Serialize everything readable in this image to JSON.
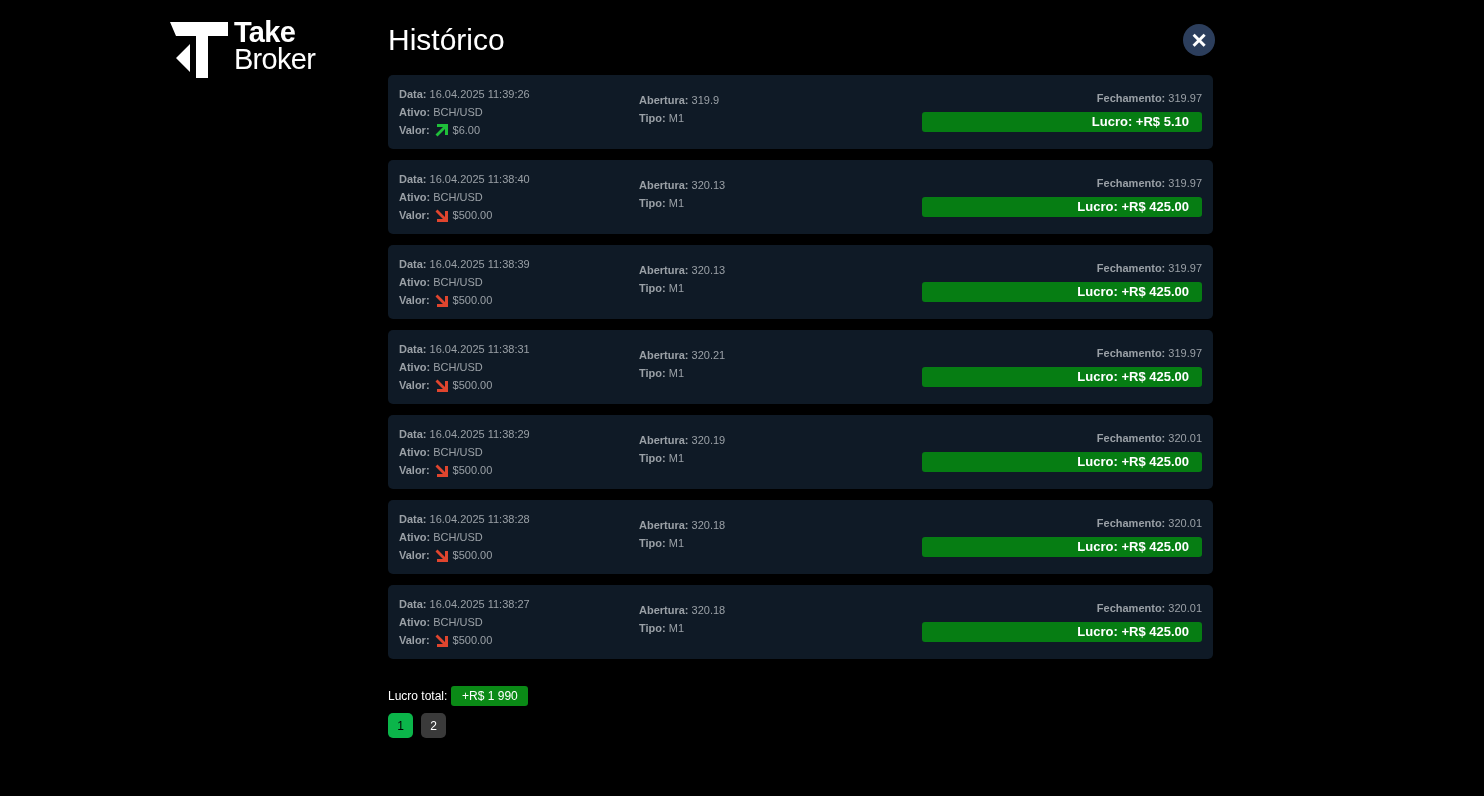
{
  "logo": {
    "line_1": "Take",
    "line_2": "Broker"
  },
  "title": "Histórico",
  "close": "×",
  "trades": [
    {
      "data": "**Data:** 16.04.2025 11:39:26",
      "ativo": "**Ativo:** BCH/USD",
      "valor_label": "Valor:",
      "kind": "up",
      "valor": "$6.00",
      "abertura": "**Abertura:** 319.9",
      "tipo": "**Tipo:** M1",
      "fechamento": "**Fechamento:** 319.97",
      "lucro": "Lucro: +R$ 5.10"
    },
    {
      "data": "**Data:** 16.04.2025 11:38:40",
      "ativo": "**Ativo:** BCH/USD",
      "valor_label": "Valor:",
      "kind": "down",
      "valor": "$500.00",
      "abertura": "**Abertura:** 320.13",
      "tipo": "**Tipo:** M1",
      "fechamento": "**Fechamento:** 319.97",
      "lucro": "Lucro: +R$ 425.00"
    },
    {
      "data": "**Data:** 16.04.2025 11:38:39",
      "ativo": "**Ativo:** BCH/USD",
      "valor_label": "Valor:",
      "kind": "down",
      "valor": "$500.00",
      "abertura": "**Abertura:** 320.13",
      "tipo": "**Tipo:** M1",
      "fechamento": "**Fechamento:** 319.97",
      "lucro": "Lucro: +R$ 425.00"
    },
    {
      "data": "**Data:** 16.04.2025 11:38:31",
      "ativo": "**Ativo:** BCH/USD",
      "valor_label": "Valor:",
      "kind": "down",
      "valor": "$500.00",
      "abertura": "**Abertura:** 320.21",
      "tipo": "**Tipo:** M1",
      "fechamento": "**Fechamento:** 319.97",
      "lucro": "Lucro: +R$ 425.00"
    },
    {
      "data": "**Data:** 16.04.2025 11:38:29",
      "ativo": "**Ativo:** BCH/USD",
      "valor_label": "Valor:",
      "kind": "down",
      "valor": "$500.00",
      "abertura": "**Abertura:** 320.19",
      "tipo": "**Tipo:** M1",
      "fechamento": "**Fechamento:** 320.01",
      "lucro": "Lucro: +R$ 425.00"
    },
    {
      "data": "**Data:** 16.04.2025 11:38:28",
      "ativo": "**Ativo:** BCH/USD",
      "valor_label": "Valor:",
      "kind": "down",
      "valor": "$500.00",
      "abertura": "**Abertura:** 320.18",
      "tipo": "**Tipo:** M1",
      "fechamento": "**Fechamento:** 320.01",
      "lucro": "Lucro: +R$ 425.00"
    },
    {
      "data": "**Data:** 16.04.2025 11:38:27",
      "ativo": "**Ativo:** BCH/USD",
      "valor_label": "Valor:",
      "kind": "down",
      "valor": "$500.00",
      "abertura": "**Abertura:** 320.18",
      "tipo": "**Tipo:** M1",
      "fechamento": "**Fechamento:** 320.01",
      "lucro": "Lucro: +R$ 425.00"
    }
  ],
  "total": {
    "label": "Lucro total:",
    "value": "+R$ 1 990"
  },
  "pages": [
    {
      "label": "1",
      "selected": true
    },
    {
      "label": "2",
      "selected": false
    }
  ]
}
